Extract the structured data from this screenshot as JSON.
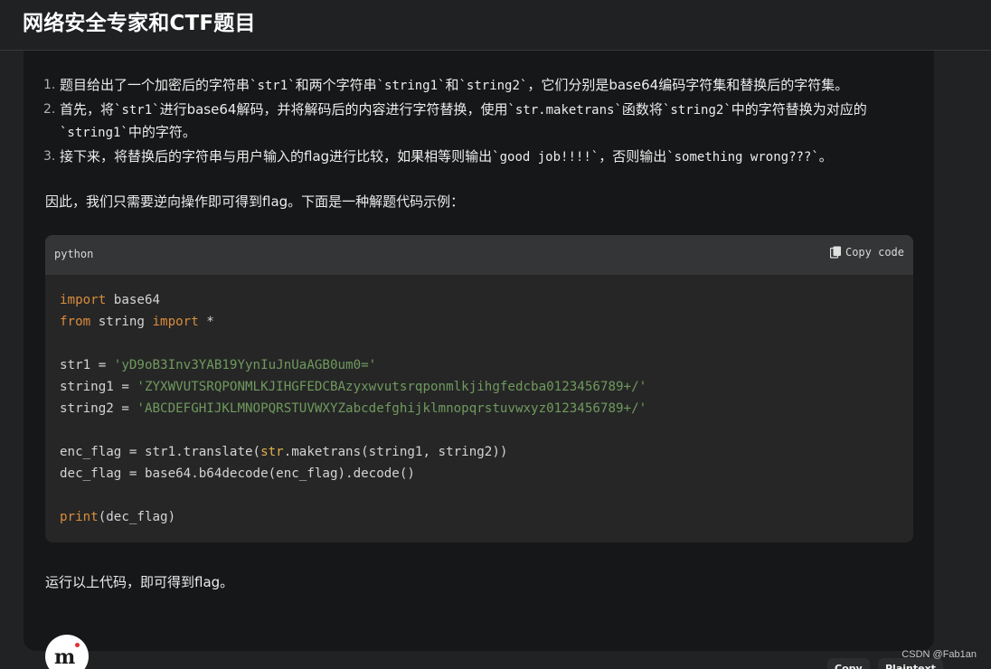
{
  "page": {
    "title": "网络安全专家和CTF题目"
  },
  "steps": [
    {
      "num": "1.",
      "parts": [
        "题目给出了一个加密后的字符串",
        "`str1`",
        "和两个字符串",
        "`string1`",
        "和",
        "`string2`",
        "，它们分别是base64编码字符集和替换后的字符集。"
      ]
    },
    {
      "num": "2.",
      "parts": [
        "首先，将",
        "`str1`",
        "进行base64解码，并将解码后的内容进行字符替换，使用",
        "`str.maketrans`",
        "函数将",
        "`string2`",
        "中的字符替换为对应的",
        "`string1`",
        "中的字符。"
      ]
    },
    {
      "num": "3.",
      "parts": [
        "接下来，将替换后的字符串与用户输入的flag进行比较，如果相等则输出",
        "`good job!!!!`",
        "，否则输出",
        "`something wrong???`",
        "。"
      ]
    }
  ],
  "intro_text": "因此，我们只需要逆向操作即可得到flag。下面是一种解题代码示例：",
  "code": {
    "language": "python",
    "copy_label": "Copy code",
    "copy_icon": "clipboard-icon",
    "lines": [
      [
        {
          "t": "import",
          "c": "kw"
        },
        {
          "t": " base64",
          "c": ""
        }
      ],
      [
        {
          "t": "from",
          "c": "kw"
        },
        {
          "t": " string ",
          "c": ""
        },
        {
          "t": "import",
          "c": "kw"
        },
        {
          "t": " *",
          "c": ""
        }
      ],
      [],
      [
        {
          "t": "str1 = ",
          "c": ""
        },
        {
          "t": "'yD9oB3Inv3YAB19YynIuJnUaAGB0um0='",
          "c": "str"
        }
      ],
      [
        {
          "t": "string1 = ",
          "c": ""
        },
        {
          "t": "'ZYXWVUTSRQPONMLKJIHGFEDCBAzyxwvutsrqponmlkjihgfedcba0123456789+/'",
          "c": "str"
        }
      ],
      [
        {
          "t": "string2 = ",
          "c": ""
        },
        {
          "t": "'ABCDEFGHIJKLMNOPQRSTUVWXYZabcdefghijklmnopqrstuvwxyz0123456789+/'",
          "c": "str"
        }
      ],
      [],
      [
        {
          "t": "enc_flag = str1.translate(",
          "c": ""
        },
        {
          "t": "str",
          "c": "bi"
        },
        {
          "t": ".maketrans(string1, string2))",
          "c": ""
        }
      ],
      [
        {
          "t": "dec_flag = base64.b64decode(enc_flag).decode()",
          "c": ""
        }
      ],
      [],
      [
        {
          "t": "print",
          "c": "kw"
        },
        {
          "t": "(dec_flag)",
          "c": ""
        }
      ]
    ]
  },
  "outro_text": "运行以上代码，即可得到flag。",
  "footer": {
    "avatar_icon": "bot-avatar-icon",
    "avatar_letter": "m",
    "copy_button": "Copy",
    "plaintext_button": "Plaintext",
    "watermark": "CSDN @Fab1an"
  },
  "colors": {
    "keyword": "#d98c3a",
    "string": "#6f9a5c",
    "builtin": "#e0b24a",
    "background": "#202223",
    "card": "#151718"
  }
}
